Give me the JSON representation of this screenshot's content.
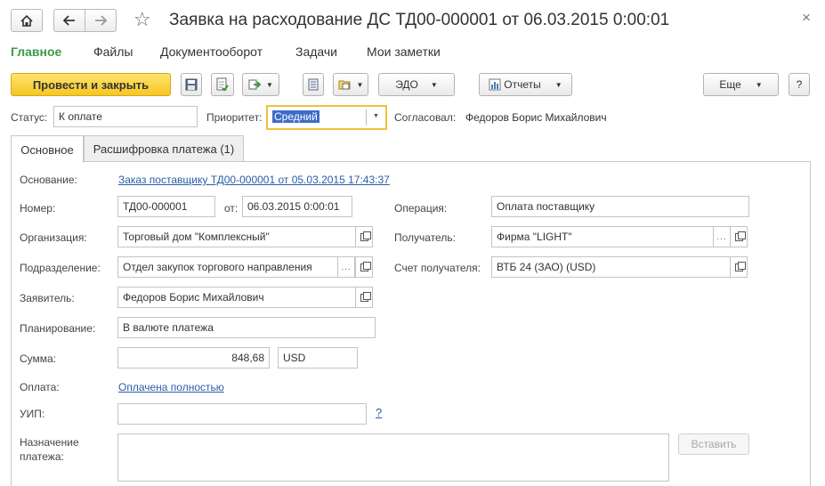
{
  "window": {
    "title": "Заявка на расходование ДС ТД00-000001 от 06.03.2015 0:00:01",
    "close_glyph": "×"
  },
  "menu": {
    "items": [
      "Главное",
      "Файлы",
      "Документооборот",
      "Задачи",
      "Мои заметки"
    ]
  },
  "toolbar": {
    "post_close": "Провести и закрыть",
    "edo": "ЭДО",
    "reports": "Отчеты",
    "more": "Еще",
    "help": "?"
  },
  "status_line": {
    "status_label": "Статус:",
    "status_value": "К оплате",
    "priority_label": "Приоритет:",
    "priority_value": "Средний",
    "approved_label": "Согласовал:",
    "approved_value": "Федоров Борис Михайлович"
  },
  "tabs": [
    "Основное",
    "Расшифровка платежа (1)"
  ],
  "form": {
    "basis_label": "Основание:",
    "basis_link": "Заказ поставщику ТД00-000001 от 05.03.2015 17:43:37",
    "number_label": "Номер:",
    "number_value": "ТД00-000001",
    "from_label": "от:",
    "date_value": "06.03.2015  0:00:01",
    "operation_label": "Операция:",
    "operation_value": "Оплата поставщику",
    "org_label": "Организация:",
    "org_value": "Торговый дом \"Комплексный\"",
    "recipient_label": "Получатель:",
    "recipient_value": "Фирма \"LIGHT\"",
    "division_label": "Подразделение:",
    "division_value": "Отдел закупок торгового направления",
    "account_label": "Счет получателя:",
    "account_value": "ВТБ 24 (ЗАО) (USD)",
    "applicant_label": "Заявитель:",
    "applicant_value": "Федоров Борис Михайлович",
    "planning_label": "Планирование:",
    "planning_value": "В валюте платежа",
    "amount_label": "Сумма:",
    "amount_value": "848,68",
    "currency_value": "USD",
    "payment_label": "Оплата:",
    "payment_link": "Оплачена полностью",
    "uip_label": "УИП:",
    "uip_value": "",
    "uip_help": "?",
    "purpose_label": "Назначение платежа:",
    "purpose_value": "",
    "insert_button": "Вставить"
  },
  "colors": {
    "accent_green": "#3a9a4a",
    "primary_yellow": "#f6c624",
    "link_blue": "#2a5ca8",
    "focus_border": "#f0c13a"
  },
  "icons": [
    "home-icon",
    "back-arrow-icon",
    "forward-arrow-icon",
    "star-icon",
    "close-icon",
    "save-icon",
    "post-icon",
    "create-based-on-icon",
    "print-icon",
    "attach-icon",
    "reports-icon",
    "open-icon"
  ]
}
